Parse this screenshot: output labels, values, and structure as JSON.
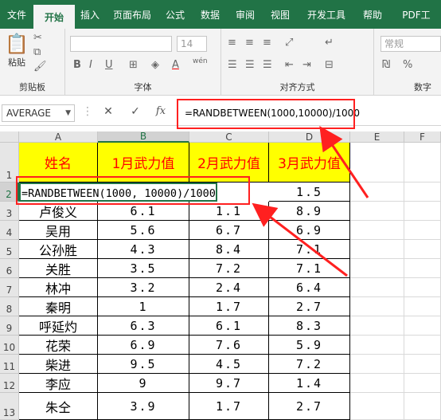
{
  "ribbon_tabs": [
    "文件",
    "开始",
    "插入",
    "页面布局",
    "公式",
    "数据",
    "审阅",
    "视图",
    "开发工具",
    "帮助",
    "PDF工"
  ],
  "active_tab": "开始",
  "groups": {
    "clipboard": "剪贴板",
    "paste_label": "粘贴",
    "font": "字体",
    "alignment": "对齐方式",
    "number": "数字",
    "font_size": "14",
    "number_format": "常规",
    "wen": "wén"
  },
  "formula_bar": {
    "name_box": "AVERAGE",
    "cancel": "✕",
    "enter": "✓",
    "fx": "fx",
    "formula": "=RANDBETWEEN(1000,10000)/1000"
  },
  "columns": [
    "A",
    "B",
    "C",
    "D",
    "E",
    "F"
  ],
  "rows": [
    "1",
    "2",
    "3",
    "4",
    "5",
    "6",
    "7",
    "8",
    "9",
    "10",
    "11",
    "12",
    "13"
  ],
  "table": {
    "headers": [
      "姓名",
      "1月武力值",
      "2月武力值",
      "3月武力值"
    ],
    "editing_text": "=RANDBETWEEN(1000, 10000)/1000",
    "row2_d": "1.5",
    "rows": [
      [
        "卢俊义",
        "6.1",
        "1.1",
        "8.9"
      ],
      [
        "吴用",
        "5.6",
        "6.7",
        "6.9"
      ],
      [
        "公孙胜",
        "4.3",
        "8.4",
        "7.1"
      ],
      [
        "关胜",
        "3.5",
        "7.2",
        "7.1"
      ],
      [
        "林冲",
        "3.2",
        "2.4",
        "6.4"
      ],
      [
        "秦明",
        "1",
        "1.7",
        "2.7"
      ],
      [
        "呼延灼",
        "6.3",
        "6.1",
        "8.3"
      ],
      [
        "花荣",
        "6.9",
        "7.6",
        "5.9"
      ],
      [
        "柴进",
        "9.5",
        "4.5",
        "7.2"
      ],
      [
        "李应",
        "9",
        "9.7",
        "1.4"
      ],
      [
        "朱仝",
        "3.9",
        "1.7",
        "2.7"
      ]
    ]
  },
  "colors": {
    "excel_green": "#217346",
    "header_fill": "#ffff00",
    "header_text": "#ff0000",
    "annotation": "#ff2020"
  }
}
